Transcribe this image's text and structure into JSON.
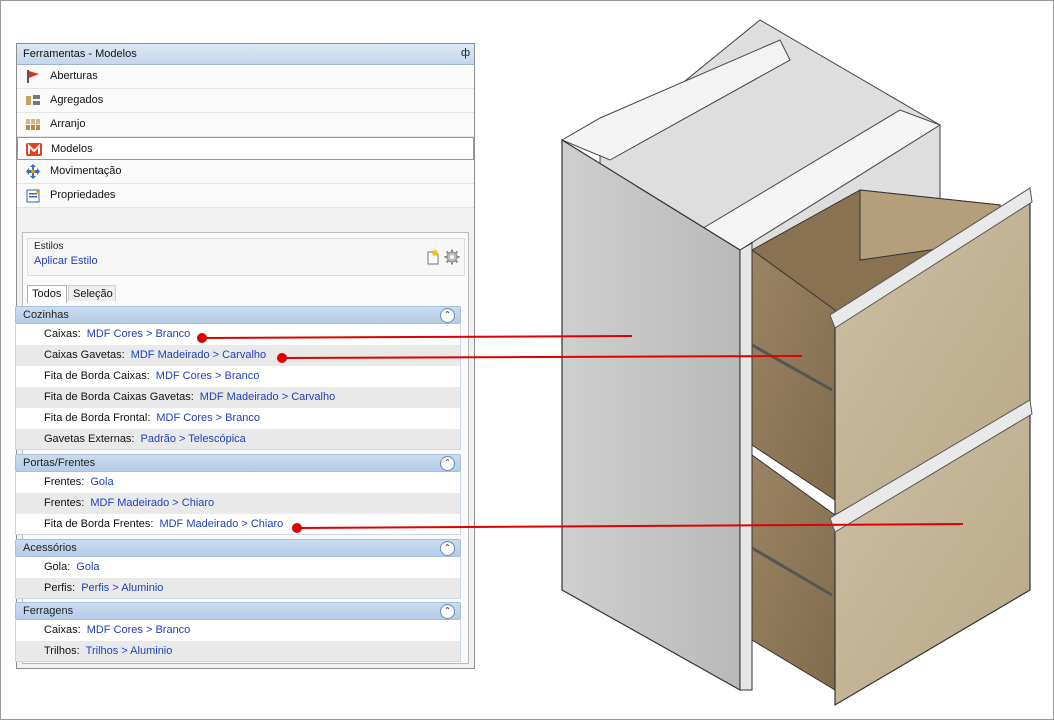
{
  "panel": {
    "title": "Ferramentas - Modelos",
    "pin": "ф",
    "menu": [
      {
        "label": "Aberturas",
        "icon": "flag-icon"
      },
      {
        "label": "Agregados",
        "icon": "aggregate-icon"
      },
      {
        "label": "Arranjo",
        "icon": "arrangement-icon"
      },
      {
        "label": "Modelos",
        "icon": "models-m-icon",
        "selected": true
      },
      {
        "label": "Movimentação",
        "icon": "move-arrows-icon"
      },
      {
        "label": "Propriedades",
        "icon": "properties-icon"
      }
    ],
    "styles": {
      "title": "Estilos",
      "apply_link": "Aplicar Estilo"
    },
    "tabs": [
      "Todos",
      "Seleção"
    ],
    "groups": [
      {
        "title": "Cozinhas",
        "rows": [
          {
            "key": "Caixas:",
            "value": "MDF Cores > Branco"
          },
          {
            "key": "Caixas Gavetas:",
            "value": "MDF Madeirado > Carvalho"
          },
          {
            "key": "Fita de Borda Caixas:",
            "value": "MDF Cores > Branco"
          },
          {
            "key": "Fita de Borda Caixas Gavetas:",
            "value": "MDF Madeirado > Carvalho"
          },
          {
            "key": "Fita de Borda Frontal:",
            "value": "MDF Cores > Branco"
          },
          {
            "key": "Gavetas Externas:",
            "value": "Padrão > Telescópica"
          }
        ]
      },
      {
        "title": "Portas/Frentes",
        "rows": [
          {
            "key": "Frentes:",
            "value": "Gola"
          },
          {
            "key": "Frentes:",
            "value": "MDF Madeirado > Chiaro"
          },
          {
            "key": "Fita de Borda Frentes:",
            "value": "MDF Madeirado > Chiaro"
          }
        ]
      },
      {
        "title": "Acessórios",
        "rows": [
          {
            "key": "Gola:",
            "value": "Gola"
          },
          {
            "key": "Perfis:",
            "value": "Perfis > Aluminio"
          }
        ]
      },
      {
        "title": "Ferragens",
        "rows": [
          {
            "key": "Caixas:",
            "value": "MDF Cores > Branco"
          },
          {
            "key": "Trilhos:",
            "value": "Trilhos > Aluminio"
          }
        ]
      }
    ]
  },
  "colors": {
    "link": "#1f3fbf",
    "callout": "#e00000",
    "header": "#c9dcf0"
  }
}
